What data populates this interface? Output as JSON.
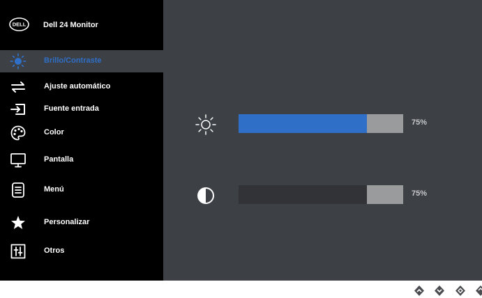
{
  "header": {
    "title": "Dell 24 Monitor",
    "logo_text": "DELL"
  },
  "menu": {
    "items": [
      {
        "label": "Brillo/Contraste",
        "icon": "brightness-icon",
        "active": true
      },
      {
        "label": "Ajuste automático",
        "icon": "auto-adjust-icon",
        "active": false
      },
      {
        "label": "Fuente entrada",
        "icon": "input-source-icon",
        "active": false
      },
      {
        "label": "Color",
        "icon": "color-palette-icon",
        "active": false
      },
      {
        "label": "Pantalla",
        "icon": "display-icon",
        "active": false
      },
      {
        "label": "Menú",
        "icon": "menu-icon",
        "active": false
      },
      {
        "label": "Personalizar",
        "icon": "star-icon",
        "active": false
      },
      {
        "label": "Otros",
        "icon": "others-icon",
        "active": false
      }
    ]
  },
  "controls": {
    "brightness": {
      "icon": "brightness-sun-icon",
      "value_label": "75%",
      "fill_fraction": 0.78,
      "fill_color": "#2f6fc7"
    },
    "contrast": {
      "icon": "contrast-icon",
      "value_label": "75%",
      "fill_fraction": 0.78,
      "fill_color": "#313336"
    }
  },
  "nav_buttons": [
    {
      "icon": "up-arrow-icon"
    },
    {
      "icon": "down-arrow-icon"
    },
    {
      "icon": "select-icon"
    },
    {
      "icon": "back-icon"
    }
  ],
  "colors": {
    "accent": "#2f6fc7",
    "panel": "#3d4045",
    "sidebar": "#000000",
    "bar_track": "#9a9b9d"
  }
}
